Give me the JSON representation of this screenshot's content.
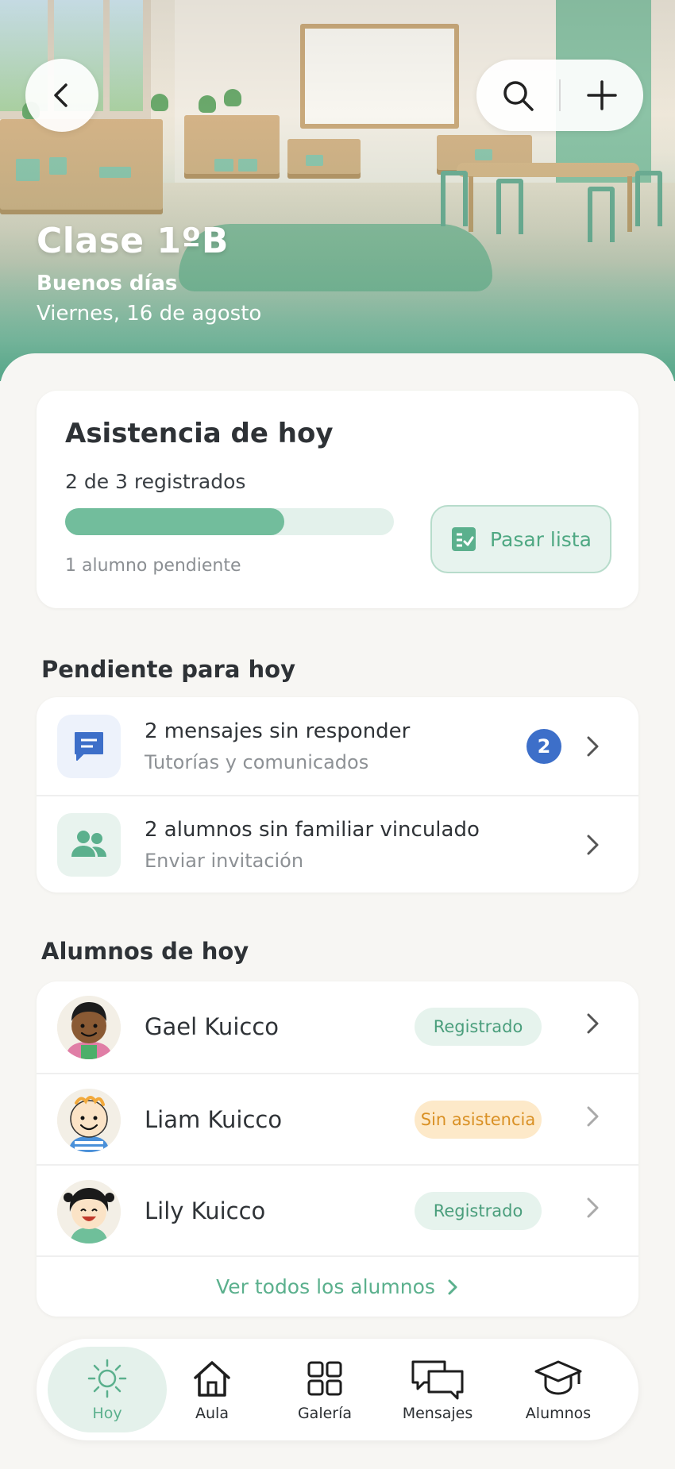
{
  "header": {
    "class_name": "Clase 1ºB",
    "greeting": "Buenos días",
    "date": "Viernes, 16 de agosto"
  },
  "attendance": {
    "title": "Asistencia de hoy",
    "count_text": "2 de 3 registrados",
    "progress_fraction": 0.6667,
    "pending_text": "1 alumno pendiente",
    "button_label": "Pasar lista"
  },
  "pending": {
    "title": "Pendiente para hoy",
    "items": [
      {
        "title": "2 mensajes sin responder",
        "subtitle": "Tutorías y comunicados",
        "badge": "2",
        "icon": "message-icon"
      },
      {
        "title": "2 alumnos sin familiar vinculado",
        "subtitle": "Enviar invitación",
        "icon": "people-icon"
      }
    ]
  },
  "students": {
    "title": "Alumnos de hoy",
    "items": [
      {
        "name": "Gael Kuicco",
        "status": "Registrado",
        "status_type": "ok"
      },
      {
        "name": "Liam Kuicco",
        "status": "Sin asistencia",
        "status_type": "warn"
      },
      {
        "name": "Lily Kuicco",
        "status": "Registrado",
        "status_type": "ok"
      }
    ],
    "see_all": "Ver todos los alumnos"
  },
  "nav": {
    "items": [
      {
        "label": "Hoy",
        "icon": "sun-icon",
        "active": true
      },
      {
        "label": "Aula",
        "icon": "home-icon"
      },
      {
        "label": "Galería",
        "icon": "grid-icon"
      },
      {
        "label": "Mensajes",
        "icon": "chat-icon"
      },
      {
        "label": "Alumnos",
        "icon": "graduation-cap-icon"
      }
    ]
  },
  "colors": {
    "accent": "#5bb08d",
    "progress_fill": "#72bd9c",
    "badge_blue": "#3d6fc9",
    "warn": "#d99024"
  }
}
